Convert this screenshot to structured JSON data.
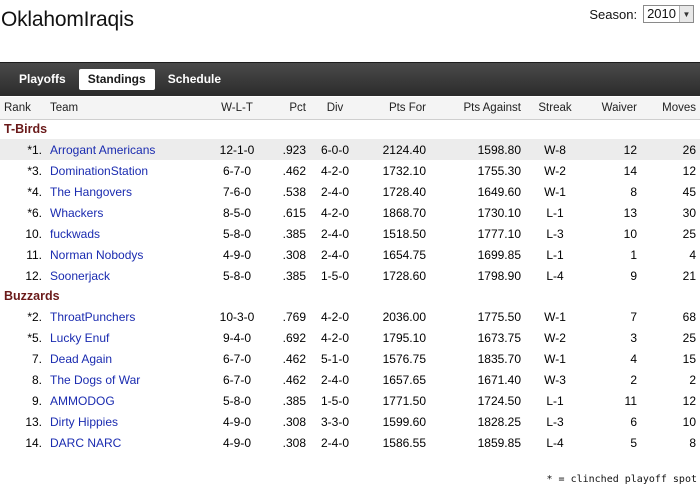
{
  "league": {
    "name": "OklahomIraqis"
  },
  "season": {
    "label": "Season:",
    "selected": "2010"
  },
  "tabs": [
    {
      "label": "Playoffs",
      "active": false
    },
    {
      "label": "Standings",
      "active": true
    },
    {
      "label": "Schedule",
      "active": false
    }
  ],
  "columns": {
    "rank": "Rank",
    "team": "Team",
    "wlt": "W-L-T",
    "pct": "Pct",
    "div": "Div",
    "pf": "Pts For",
    "pa": "Pts Against",
    "streak": "Streak",
    "waiver": "Waiver",
    "moves": "Moves"
  },
  "divisions": [
    {
      "name": "T-Birds",
      "teams": [
        {
          "rank": "*1.",
          "team": "Arrogant Americans",
          "wlt": "12-1-0",
          "pct": ".923",
          "div": "6-0-0",
          "pf": "2124.40",
          "pa": "1598.80",
          "streak": "W-8",
          "waiver": "12",
          "moves": "26"
        },
        {
          "rank": "*3.",
          "team": "DominationStation",
          "wlt": "6-7-0",
          "pct": ".462",
          "div": "4-2-0",
          "pf": "1732.10",
          "pa": "1755.30",
          "streak": "W-2",
          "waiver": "14",
          "moves": "12"
        },
        {
          "rank": "*4.",
          "team": "The Hangovers",
          "wlt": "7-6-0",
          "pct": ".538",
          "div": "2-4-0",
          "pf": "1728.40",
          "pa": "1649.60",
          "streak": "W-1",
          "waiver": "8",
          "moves": "45"
        },
        {
          "rank": "*6.",
          "team": "Whackers",
          "wlt": "8-5-0",
          "pct": ".615",
          "div": "4-2-0",
          "pf": "1868.70",
          "pa": "1730.10",
          "streak": "L-1",
          "waiver": "13",
          "moves": "30"
        },
        {
          "rank": "10.",
          "team": "fuckwads",
          "wlt": "5-8-0",
          "pct": ".385",
          "div": "2-4-0",
          "pf": "1518.50",
          "pa": "1777.10",
          "streak": "L-3",
          "waiver": "10",
          "moves": "25"
        },
        {
          "rank": "11.",
          "team": "Norman Nobodys",
          "wlt": "4-9-0",
          "pct": ".308",
          "div": "2-4-0",
          "pf": "1654.75",
          "pa": "1699.85",
          "streak": "L-1",
          "waiver": "1",
          "moves": "4"
        },
        {
          "rank": "12.",
          "team": "Soonerjack",
          "wlt": "5-8-0",
          "pct": ".385",
          "div": "1-5-0",
          "pf": "1728.60",
          "pa": "1798.90",
          "streak": "L-4",
          "waiver": "9",
          "moves": "21"
        }
      ]
    },
    {
      "name": "Buzzards",
      "teams": [
        {
          "rank": "*2.",
          "team": "ThroatPunchers",
          "wlt": "10-3-0",
          "pct": ".769",
          "div": "4-2-0",
          "pf": "2036.00",
          "pa": "1775.50",
          "streak": "W-1",
          "waiver": "7",
          "moves": "68"
        },
        {
          "rank": "*5.",
          "team": "Lucky Enuf",
          "wlt": "9-4-0",
          "pct": ".692",
          "div": "4-2-0",
          "pf": "1795.10",
          "pa": "1673.75",
          "streak": "W-2",
          "waiver": "3",
          "moves": "25"
        },
        {
          "rank": "7.",
          "team": "Dead Again",
          "wlt": "6-7-0",
          "pct": ".462",
          "div": "5-1-0",
          "pf": "1576.75",
          "pa": "1835.70",
          "streak": "W-1",
          "waiver": "4",
          "moves": "15"
        },
        {
          "rank": "8.",
          "team": "The Dogs of War",
          "wlt": "6-7-0",
          "pct": ".462",
          "div": "2-4-0",
          "pf": "1657.65",
          "pa": "1671.40",
          "streak": "W-3",
          "waiver": "2",
          "moves": "2"
        },
        {
          "rank": "9.",
          "team": "AMMODOG",
          "wlt": "5-8-0",
          "pct": ".385",
          "div": "1-5-0",
          "pf": "1771.50",
          "pa": "1724.50",
          "streak": "L-1",
          "waiver": "11",
          "moves": "12"
        },
        {
          "rank": "13.",
          "team": "Dirty Hippies",
          "wlt": "4-9-0",
          "pct": ".308",
          "div": "3-3-0",
          "pf": "1599.60",
          "pa": "1828.25",
          "streak": "L-3",
          "waiver": "6",
          "moves": "10"
        },
        {
          "rank": "14.",
          "team": "DARC NARC",
          "wlt": "4-9-0",
          "pct": ".308",
          "div": "2-4-0",
          "pf": "1586.55",
          "pa": "1859.85",
          "streak": "L-4",
          "waiver": "5",
          "moves": "8"
        }
      ]
    }
  ],
  "footnote": "* = clinched playoff spot",
  "colors": {
    "link": "#1a2bb0",
    "division": "#6a1a1a",
    "tabbar": "#333333"
  }
}
